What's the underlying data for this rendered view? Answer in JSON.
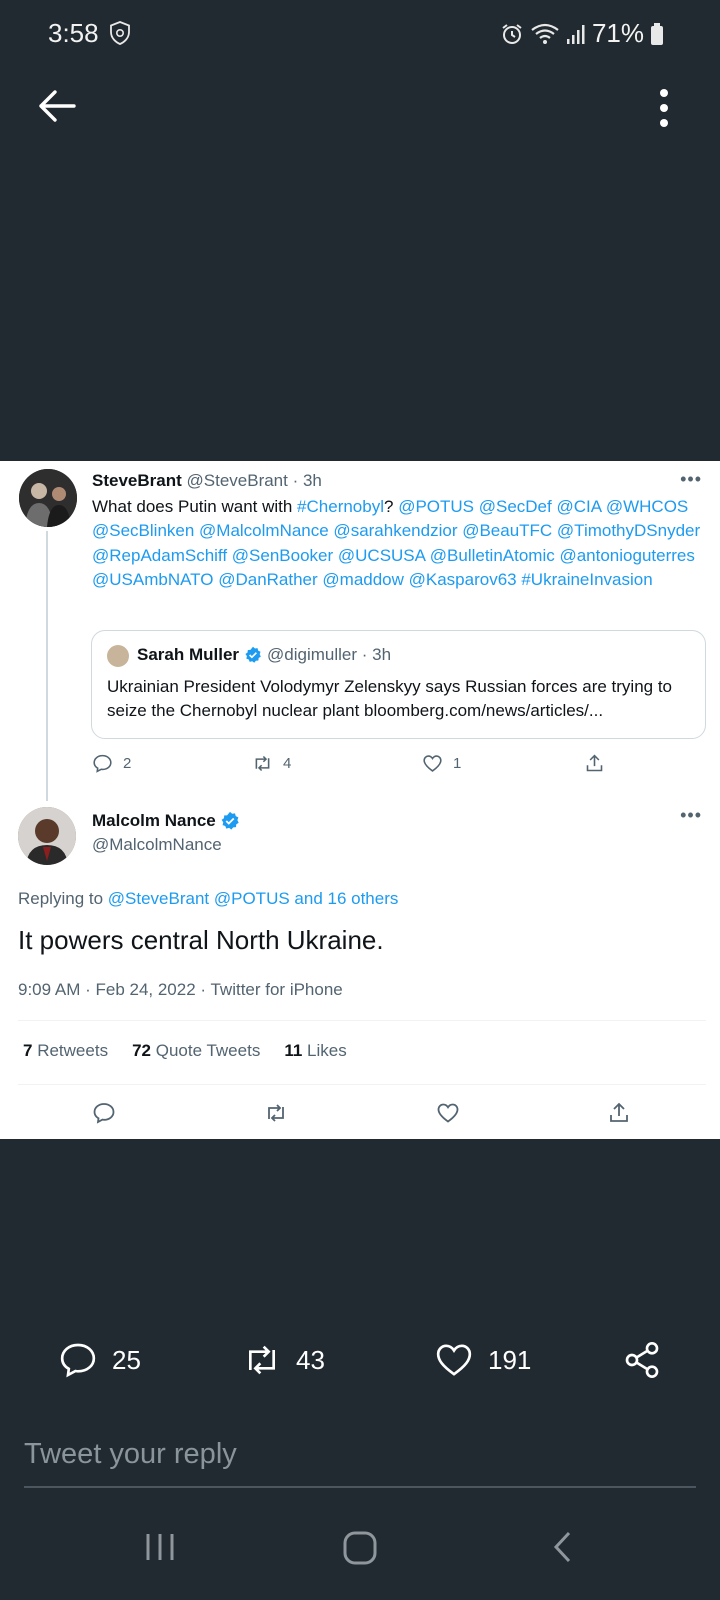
{
  "status_bar": {
    "time": "3:58",
    "battery": "71%"
  },
  "tweet1": {
    "name": "SteveBrant",
    "meta": "@SteveBrant · 3h",
    "more": "•••",
    "body_parts": [
      {
        "text": "What does Putin want with ",
        "link": false
      },
      {
        "text": "#Chernobyl",
        "link": true
      },
      {
        "text": "? ",
        "link": false
      },
      {
        "text": "@POTUS @SecDef @CIA @WHCOS @SecBlinken @MalcolmNance @sarahkendzior @BeauTFC @TimothyDSnyder @RepAdamSchiff @SenBooker @UCSUSA @BulletinAtomic @antonioguterres @USAmbNATO @DanRather @maddow @Kasparov63 #UkraineInvasion",
        "link": true
      }
    ],
    "quote": {
      "name": "Sarah Muller",
      "meta": "@digimuller · 3h",
      "body": "Ukrainian President Volodymyr Zelenskyy says Russian forces are trying to seize the Chernobyl nuclear plant bloomberg.com/news/articles/..."
    },
    "actions": {
      "replies": "2",
      "retweets": "4",
      "likes": "1"
    }
  },
  "tweet2": {
    "name": "Malcolm Nance",
    "handle": "@MalcolmNance",
    "more": "•••",
    "replying_prefix": "Replying to ",
    "replying_targets": "@SteveBrant @POTUS and 16 others",
    "text": "It powers central North Ukraine.",
    "meta": "9:09 AM · Feb 24, 2022 · Twitter for iPhone",
    "stats": [
      {
        "count": "7",
        "label": "Retweets"
      },
      {
        "count": "72",
        "label": "Quote Tweets"
      },
      {
        "count": "11",
        "label": "Likes"
      }
    ]
  },
  "bottom": {
    "replies": "25",
    "retweets": "43",
    "likes": "191",
    "reply_placeholder": "Tweet your reply"
  },
  "colors": {
    "background": "#212a30",
    "link": "#1d9bf0",
    "muted": "#536471"
  }
}
